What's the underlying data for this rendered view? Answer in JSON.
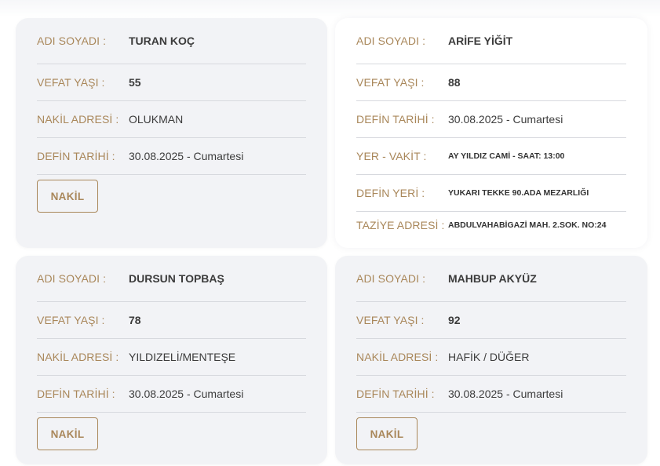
{
  "cards": [
    {
      "rows": [
        {
          "label": "ADI SOYADI :",
          "value": "TURAN KOÇ"
        },
        {
          "label": "VEFAT YAŞI :",
          "value": "55"
        },
        {
          "label": "NAKİL ADRESİ :",
          "value": "OLUKMAN"
        },
        {
          "label": "DEFİN TARİHİ :",
          "value": "30.08.2025 - Cumartesi"
        }
      ],
      "button": "NAKİL"
    },
    {
      "rows": [
        {
          "label": "ADI SOYADI :",
          "value": "ARİFE YİĞİT"
        },
        {
          "label": "VEFAT YAŞI :",
          "value": "88"
        },
        {
          "label": "DEFİN TARİHİ :",
          "value": "30.08.2025 - Cumartesi"
        },
        {
          "label": "YER - VAKİT :",
          "value": "AY YILDIZ CAMİ - SAAT: 13:00"
        },
        {
          "label": "DEFİN YERİ :",
          "value": "YUKARI TEKKE 90.ADA MEZARLIĞI"
        },
        {
          "label": "TAZİYE ADRESİ :",
          "value": "ABDULVAHABİGAZİ MAH. 2.SOK. NO:24"
        }
      ]
    },
    {
      "rows": [
        {
          "label": "ADI SOYADI :",
          "value": "DURSUN TOPBAŞ"
        },
        {
          "label": "VEFAT YAŞI :",
          "value": "78"
        },
        {
          "label": "NAKİL ADRESİ :",
          "value": "YILDIZELİ/MENTEŞE"
        },
        {
          "label": "DEFİN TARİHİ :",
          "value": "30.08.2025 - Cumartesi"
        }
      ],
      "button": "NAKİL"
    },
    {
      "rows": [
        {
          "label": "ADI SOYADI :",
          "value": "MAHBUP AKYÜZ"
        },
        {
          "label": "VEFAT YAŞI :",
          "value": "92"
        },
        {
          "label": "NAKİL ADRESİ :",
          "value": "HAFİK / DÜĞER"
        },
        {
          "label": "DEFİN TARİHİ :",
          "value": "30.08.2025 - Cumartesi"
        }
      ],
      "button": "NAKİL"
    }
  ],
  "colors": {
    "label": "#a9875a",
    "value": "#3c3c3c",
    "card_gray": "#f2f3f6",
    "divider": "#d7d9de"
  }
}
